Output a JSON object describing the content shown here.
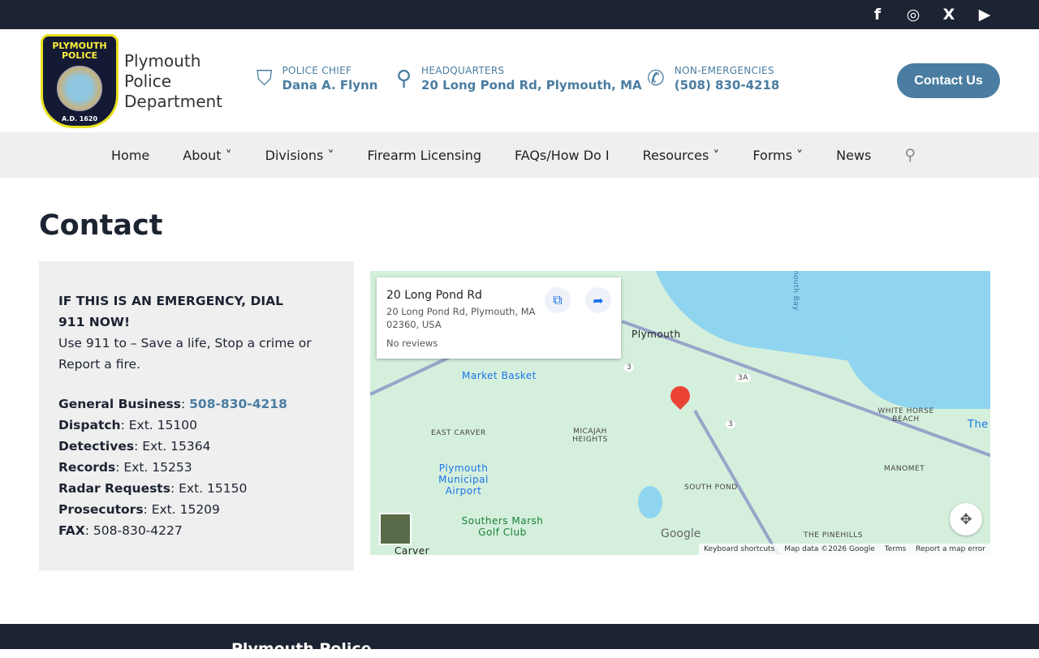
{
  "social": [
    {
      "icon": "facebook-icon",
      "glyph": "f"
    },
    {
      "icon": "instagram-icon",
      "glyph": "◎"
    },
    {
      "icon": "x-icon",
      "glyph": "X"
    },
    {
      "icon": "youtube-icon",
      "glyph": "▶"
    }
  ],
  "logo": {
    "top": "PLYMOUTH POLICE",
    "bottom": "A.D. 1620"
  },
  "dept_name": [
    "Plymouth",
    "Police",
    "Department"
  ],
  "info": [
    {
      "label": "POLICE CHIEF",
      "value": "Dana A. Flynn",
      "glyph": "⛉"
    },
    {
      "label": "HEADQUARTERS",
      "value": "20 Long Pond Rd, Plymouth, MA",
      "glyph": "⚲"
    },
    {
      "label": "NON-EMERGENCIES",
      "value": "(508) 830-4218",
      "glyph": "✆"
    }
  ],
  "contact_button": "Contact Us",
  "nav": [
    "Home",
    "About ˅",
    "Divisions ˅",
    "Firearm Licensing",
    "FAQs/How Do I",
    "Resources ˅",
    "Forms ˅",
    "News"
  ],
  "page_title": "Contact",
  "panel": {
    "emergency": "IF THIS IS AN EMERGENCY, DIAL 911 NOW!",
    "emergency_sub": "Use 911 to – Save a life, Stop a crime or Report a fire.",
    "lines": [
      {
        "k": "General Business",
        "v": "508-830-4218",
        "link": true
      },
      {
        "k": "Dispatch",
        "v": "Ext. 15100"
      },
      {
        "k": "Detectives",
        "v": "Ext. 15364"
      },
      {
        "k": "Records",
        "v": "Ext. 15253"
      },
      {
        "k": "Radar Requests",
        "v": "Ext. 15150"
      },
      {
        "k": "Prosecutors",
        "v": "Ext. 15209"
      },
      {
        "k": "FAX",
        "v": "508-830-4227"
      }
    ]
  },
  "map": {
    "card_title": "20 Long Pond Rd",
    "card_addr": "20 Long Pond Rd, Plymouth, MA 02360, USA",
    "card_reviews": "No reviews",
    "labels": [
      "Plymouth",
      "Market Basket",
      "EAST CARVER",
      "MICAJAH HEIGHTS",
      "Plymouth Municipal Airport",
      "Southers Marsh Golf Club",
      "SOUTH POND",
      "WHITE HORSE BEACH",
      "MANOMET",
      "THE PINEHILLS",
      "Carver",
      "The",
      "Plymouth Bay",
      "3",
      "3A",
      "3"
    ],
    "attribution": [
      "Keyboard shortcuts",
      "Map data ©2026 Google",
      "Terms",
      "Report a map error"
    ],
    "google": "Google"
  },
  "footer_title": "Plymouth Police"
}
